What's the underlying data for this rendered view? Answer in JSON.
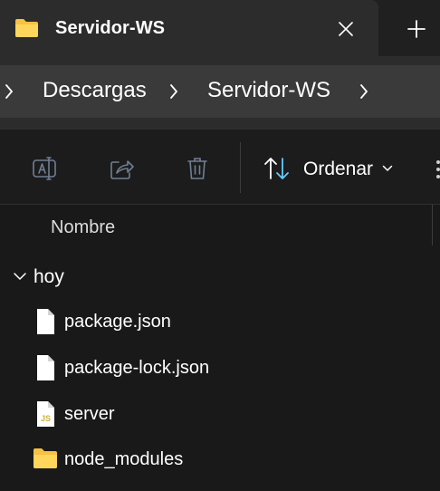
{
  "tab": {
    "title": "Servidor-WS",
    "close_icon": "close-icon",
    "new_tab_icon": "plus-icon"
  },
  "breadcrumb": {
    "items": [
      "Descargas",
      "Servidor-WS"
    ]
  },
  "toolbar": {
    "rename_icon": "rename-icon",
    "share_icon": "share-icon",
    "delete_icon": "trash-icon",
    "sort_label": "Ordenar",
    "sort_icon": "sort-arrows-icon",
    "more_icon": "more-icon"
  },
  "list": {
    "column_name": "Nombre",
    "group_label": "hoy",
    "files": [
      {
        "name": "package.json",
        "icon": "file-icon"
      },
      {
        "name": "package-lock.json",
        "icon": "file-icon"
      },
      {
        "name": "server",
        "icon": "js-file-icon"
      },
      {
        "name": "node_modules",
        "icon": "folder-icon"
      }
    ]
  },
  "colors": {
    "folder": "#f5c242",
    "background": "#191919",
    "accent_js": "#c8b43a"
  }
}
